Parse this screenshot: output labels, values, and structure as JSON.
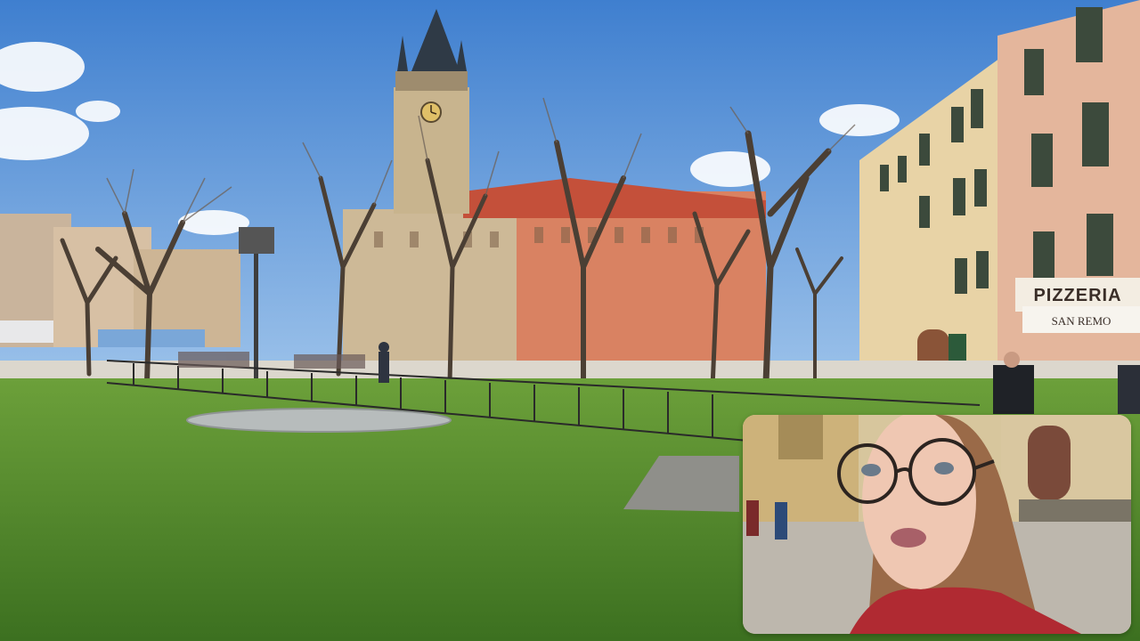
{
  "video": {
    "main_scene": "city-square",
    "overlay": "webcam-picture-in-picture"
  },
  "signage": {
    "pizzeria": "PIZZERIA",
    "restaurant": "SAN REMO"
  },
  "colors": {
    "sky": "#5f95d6",
    "grass": "#4f8a2c",
    "facade_pink": "#e4b69c",
    "facade_yellow": "#e8d3a6",
    "tower": "#c8b48e",
    "roof_red": "#c4503a"
  }
}
